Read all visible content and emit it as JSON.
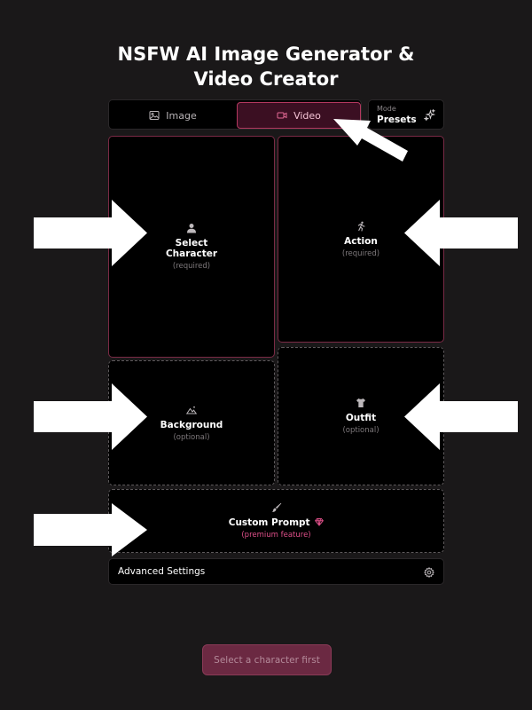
{
  "page": {
    "title_line1": "NSFW AI Image Generator &",
    "title_line2": "Video Creator"
  },
  "mode_tabs": {
    "image_label": "Image",
    "video_label": "Video",
    "active": "Video"
  },
  "presets": {
    "caption": "Mode",
    "label": "Presets"
  },
  "cards": {
    "character": {
      "label": "Select Character",
      "sub": "(required)"
    },
    "action": {
      "label": "Action",
      "sub": "(required)"
    },
    "background": {
      "label": "Background",
      "sub": "(optional)"
    },
    "outfit": {
      "label": "Outfit",
      "sub": "(optional)"
    },
    "custom_prompt": {
      "label": "Custom Prompt",
      "sub": "(premium feature)"
    }
  },
  "advanced": {
    "label": "Advanced Settings"
  },
  "generate_button": {
    "label": "Select a character first",
    "enabled": false
  },
  "colors": {
    "background": "#1a1819",
    "panel": "#000000",
    "accent_border": "#b3385f",
    "premium": "#e0508a",
    "button": "#6b2942"
  },
  "icons": {
    "image_tab": "image-icon",
    "video_tab": "video-icon",
    "presets": "sparkles-icon",
    "character": "user-icon",
    "action": "running-icon",
    "background": "mountain-icon",
    "outfit": "shirt-icon",
    "custom_prompt": "brush-icon",
    "premium": "gem-icon",
    "advanced": "gear-icon"
  }
}
